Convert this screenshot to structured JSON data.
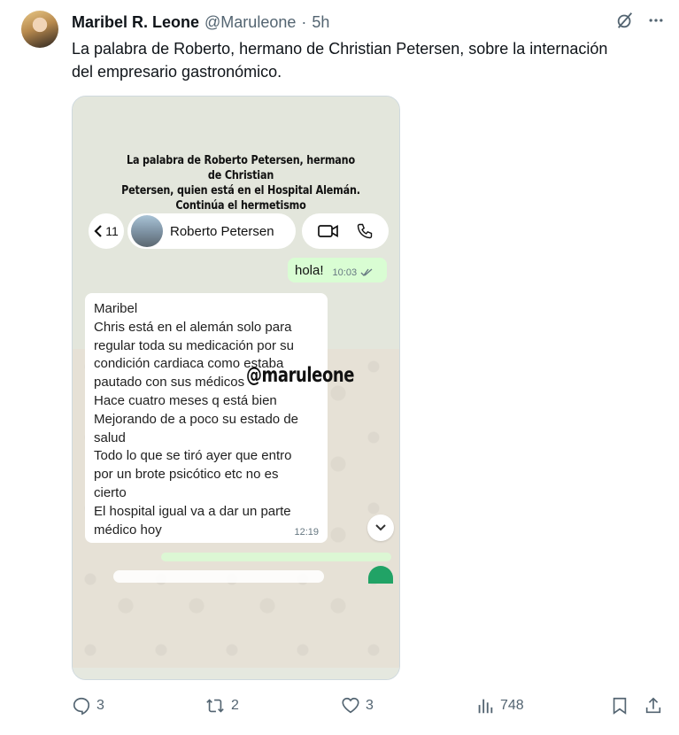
{
  "tweet": {
    "author_name": "Maribel R. Leone",
    "author_handle": "@Maruleone",
    "separator": "·",
    "time": "5h",
    "text_line1": "La palabra de Roberto, hermano de Christian Petersen, sobre la internación",
    "text_line2": "del empresario gastronómico."
  },
  "media": {
    "headline_line1": "La palabra de Roberto Petersen, hermano de Christian",
    "headline_line2": "Petersen, quien está en el Hospital Alemán.",
    "headline_line3": "Continúa el hermetismo",
    "back_count": "11",
    "contact_name": "Roberto Petersen",
    "sent_message": "hola!",
    "sent_time": "10:03",
    "received_lines": [
      "Maribel",
      "Chris está en el alemán solo para",
      "regular toda su medicación por su",
      "condición cardiaca  como estaba",
      "pautado con sus médicos",
      "Hace cuatro meses q está bien",
      "Mejorando de a poco su estado de",
      "salud",
      "Todo lo que se tiró ayer que entro",
      "por un brote psicótico etc no es",
      "cierto",
      "El hospital igual va a dar un parte",
      "médico hoy"
    ],
    "received_time": "12:19",
    "watermark": "@maruleone"
  },
  "actions": {
    "replies": "3",
    "reposts": "2",
    "likes": "3",
    "views": "748"
  },
  "icons": {
    "reply": "reply-icon",
    "repost": "repost-icon",
    "like": "heart-icon",
    "views": "views-icon",
    "bookmark": "bookmark-icon",
    "share": "share-icon",
    "grok": "grok-icon",
    "more": "more-icon"
  },
  "colors": {
    "secondary_text": "#536471",
    "whatsapp_sent": "#d9fdd3",
    "whatsapp_green": "#21a366"
  }
}
